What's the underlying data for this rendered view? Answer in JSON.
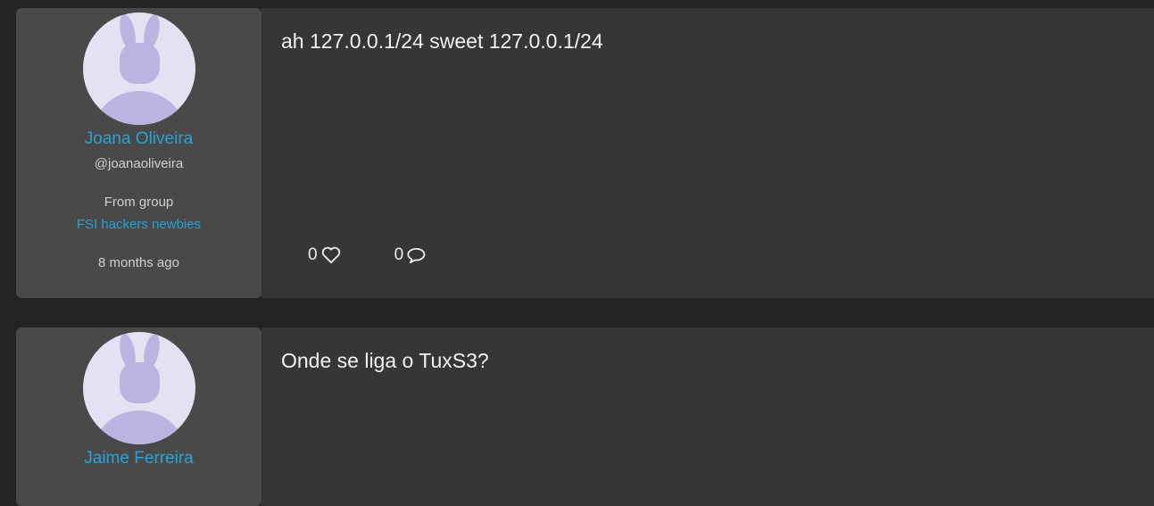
{
  "posts": [
    {
      "author": "Joana Oliveira",
      "handle": "@joanaoliveira",
      "from_label": "From group",
      "group": "FSI hackers newbies",
      "time": "8 months ago",
      "text": "ah 127.0.0.1/24 sweet 127.0.0.1/24",
      "likes": "0",
      "comments": "0"
    },
    {
      "author": "Jaime Ferreira",
      "text": "Onde se liga o TuxS3?"
    }
  ],
  "colors": {
    "link": "#29a3d6",
    "avatar_bg": "#e6e0f3",
    "avatar_fg": "#bdb3e0"
  }
}
